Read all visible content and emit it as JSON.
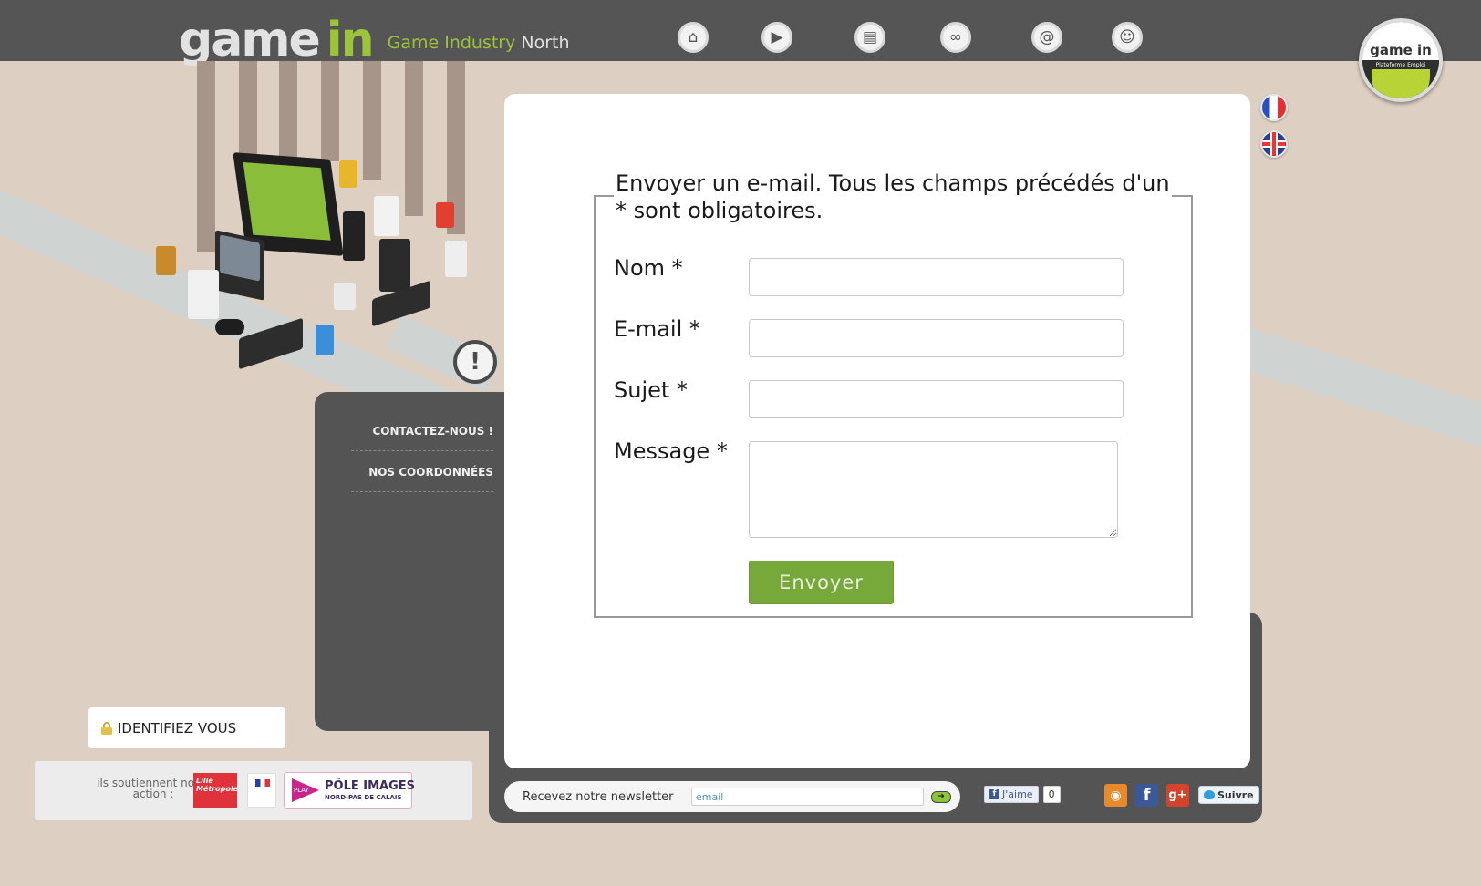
{
  "header": {
    "logo_game": "game",
    "logo_in": "in",
    "logo_sub_main": "Game Industry ",
    "logo_sub_north": "North",
    "nav_icons": [
      "home-icon",
      "play-icon",
      "document-icon",
      "link-icon",
      "at-icon",
      "users-icon"
    ],
    "badge_top": "game in",
    "badge_sub": "Plateforme Emploi"
  },
  "sidebar": {
    "items": [
      {
        "label": "CONTACTEZ-NOUS !"
      },
      {
        "label": "NOS COORDONNÉES"
      }
    ],
    "login_label": "IDENTIFIEZ VOUS",
    "supporters_text": "ils soutiennent notre action :",
    "supporter_lille": "Lille Métropole",
    "supporter_pole_play": "PLAY",
    "supporter_pole_title": "PÔLE IMAGES",
    "supporter_pole_sub": "NORD-PAS DE CALAIS"
  },
  "form": {
    "legend": "Envoyer un e-mail. Tous les champs précédés d'un * sont obligatoires.",
    "fields": [
      {
        "label": "Nom *",
        "value": ""
      },
      {
        "label": "E-mail *",
        "value": ""
      },
      {
        "label": "Sujet *",
        "value": ""
      },
      {
        "label": "Message *",
        "value": ""
      }
    ],
    "submit_label": "Envoyer"
  },
  "footer": {
    "newsletter_label": "Recevez notre newsletter",
    "newsletter_placeholder": "email",
    "fb_like_label": "J'aime",
    "fb_like_count": "0",
    "twitter_follow": "Suivre"
  },
  "languages": [
    "fr",
    "en"
  ],
  "colors": {
    "topbar": "#555555",
    "accent_green": "#9cc43a",
    "button_green": "#77a83a",
    "background": "#ddd0c2",
    "panel_dark": "#545454"
  }
}
